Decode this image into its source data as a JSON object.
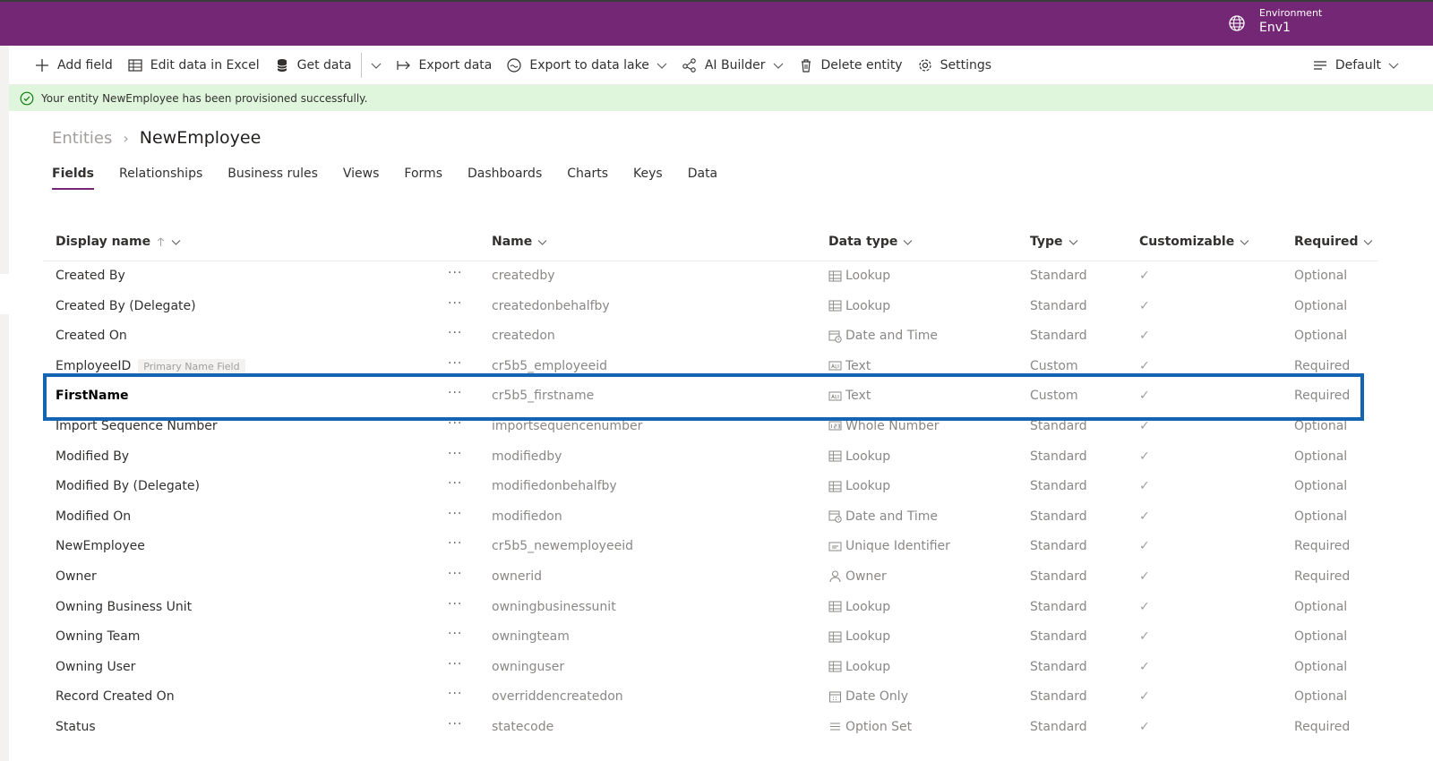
{
  "header": {
    "env_label": "Environment",
    "env_name": "Env1"
  },
  "toolbar": {
    "add_field": "Add field",
    "edit_excel": "Edit data in Excel",
    "get_data": "Get data",
    "export_data": "Export data",
    "export_lake": "Export to data lake",
    "ai_builder": "AI Builder",
    "delete_entity": "Delete entity",
    "settings": "Settings",
    "view": "Default"
  },
  "banner": {
    "message": "Your entity NewEmployee has been provisioned successfully."
  },
  "breadcrumb": {
    "root": "Entities",
    "current": "NewEmployee"
  },
  "tabs": [
    "Fields",
    "Relationships",
    "Business rules",
    "Views",
    "Forms",
    "Dashboards",
    "Charts",
    "Keys",
    "Data"
  ],
  "columns": {
    "display_name": "Display name",
    "name": "Name",
    "data_type": "Data type",
    "type": "Type",
    "customizable": "Customizable",
    "required": "Required"
  },
  "rows": [
    {
      "display": "Created By",
      "name": "createdby",
      "icon": "lookup-icon",
      "dtype": "Lookup",
      "type": "Standard",
      "req": "Optional"
    },
    {
      "display": "Created By (Delegate)",
      "name": "createdonbehalfby",
      "icon": "lookup-icon",
      "dtype": "Lookup",
      "type": "Standard",
      "req": "Optional"
    },
    {
      "display": "Created On",
      "name": "createdon",
      "icon": "datetime-icon",
      "dtype": "Date and Time",
      "type": "Standard",
      "req": "Optional"
    },
    {
      "display": "EmployeeID",
      "badge": "Primary Name Field",
      "name": "cr5b5_employeeid",
      "icon": "text-icon",
      "dtype": "Text",
      "type": "Custom",
      "req": "Required"
    },
    {
      "display": "FirstName",
      "name": "cr5b5_firstname",
      "icon": "text-icon",
      "dtype": "Text",
      "type": "Custom",
      "req": "Required"
    },
    {
      "display": "Import Sequence Number",
      "name": "importsequencenumber",
      "icon": "number-icon",
      "dtype": "Whole Number",
      "type": "Standard",
      "req": "Optional"
    },
    {
      "display": "Modified By",
      "name": "modifiedby",
      "icon": "lookup-icon",
      "dtype": "Lookup",
      "type": "Standard",
      "req": "Optional"
    },
    {
      "display": "Modified By (Delegate)",
      "name": "modifiedonbehalfby",
      "icon": "lookup-icon",
      "dtype": "Lookup",
      "type": "Standard",
      "req": "Optional"
    },
    {
      "display": "Modified On",
      "name": "modifiedon",
      "icon": "datetime-icon",
      "dtype": "Date and Time",
      "type": "Standard",
      "req": "Optional"
    },
    {
      "display": "NewEmployee",
      "name": "cr5b5_newemployeeid",
      "icon": "id-icon",
      "dtype": "Unique Identifier",
      "type": "Standard",
      "req": "Required"
    },
    {
      "display": "Owner",
      "name": "ownerid",
      "icon": "person-icon",
      "dtype": "Owner",
      "type": "Standard",
      "req": "Required"
    },
    {
      "display": "Owning Business Unit",
      "name": "owningbusinessunit",
      "icon": "lookup-icon",
      "dtype": "Lookup",
      "type": "Standard",
      "req": "Optional"
    },
    {
      "display": "Owning Team",
      "name": "owningteam",
      "icon": "lookup-icon",
      "dtype": "Lookup",
      "type": "Standard",
      "req": "Optional"
    },
    {
      "display": "Owning User",
      "name": "owninguser",
      "icon": "lookup-icon",
      "dtype": "Lookup",
      "type": "Standard",
      "req": "Optional"
    },
    {
      "display": "Record Created On",
      "name": "overriddencreatedon",
      "icon": "dateonly-icon",
      "dtype": "Date Only",
      "type": "Standard",
      "req": "Optional"
    },
    {
      "display": "Status",
      "name": "statecode",
      "icon": "optionset-icon",
      "dtype": "Option Set",
      "type": "Standard",
      "req": "Required"
    }
  ],
  "selected_row": 4,
  "colors": {
    "brand": "#742774",
    "highlight": "#1464b4",
    "success_bg": "#dff6dd"
  }
}
